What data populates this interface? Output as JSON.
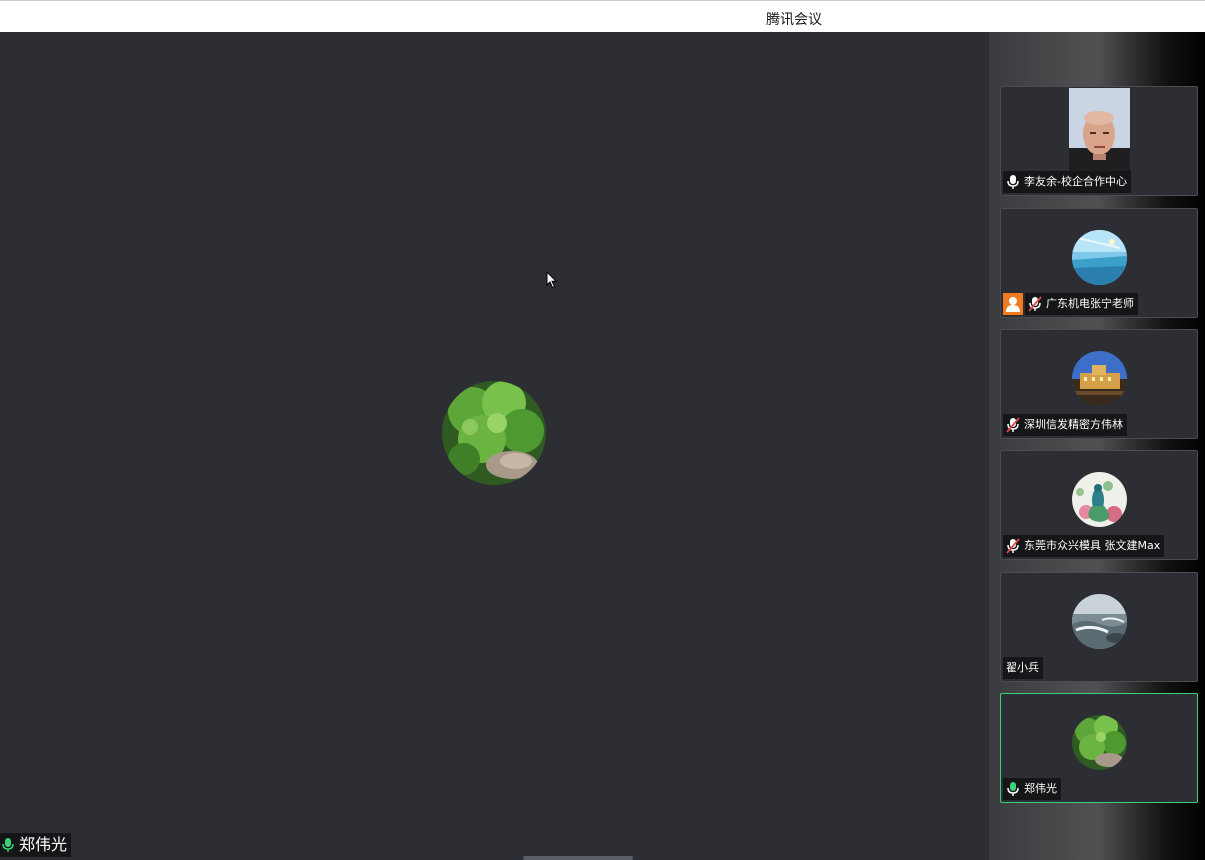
{
  "window": {
    "title": "腾讯会议"
  },
  "main": {
    "speaker_name": "郑伟光",
    "speaker_mic": "mic-on",
    "speaker_avatar": "leafy-plant-avatar"
  },
  "participants": [
    {
      "name": "李友余-校企合作中心",
      "mic": "mic-on",
      "avatar": "video-man-face"
    },
    {
      "name": "广东机电张宁老师",
      "mic": "mic-muted",
      "avatar": "sky-sea-avatar",
      "badge": "person-icon"
    },
    {
      "name": "深圳信发精密方伟林",
      "mic": "mic-muted",
      "avatar": "castle-avatar"
    },
    {
      "name": "东莞市众兴模具 张文建Max",
      "mic": "mic-muted",
      "avatar": "peacock-avatar"
    },
    {
      "name": "翟小兵",
      "mic": "none",
      "avatar": "ocean-avatar"
    },
    {
      "name": "郑伟光",
      "mic": "mic-on-green",
      "avatar": "leafy-plant-avatar",
      "active": true
    }
  ],
  "colors": {
    "active_border": "#3ecf7a",
    "mic_green": "#3ecf7a",
    "badge_orange": "#f07b21"
  }
}
